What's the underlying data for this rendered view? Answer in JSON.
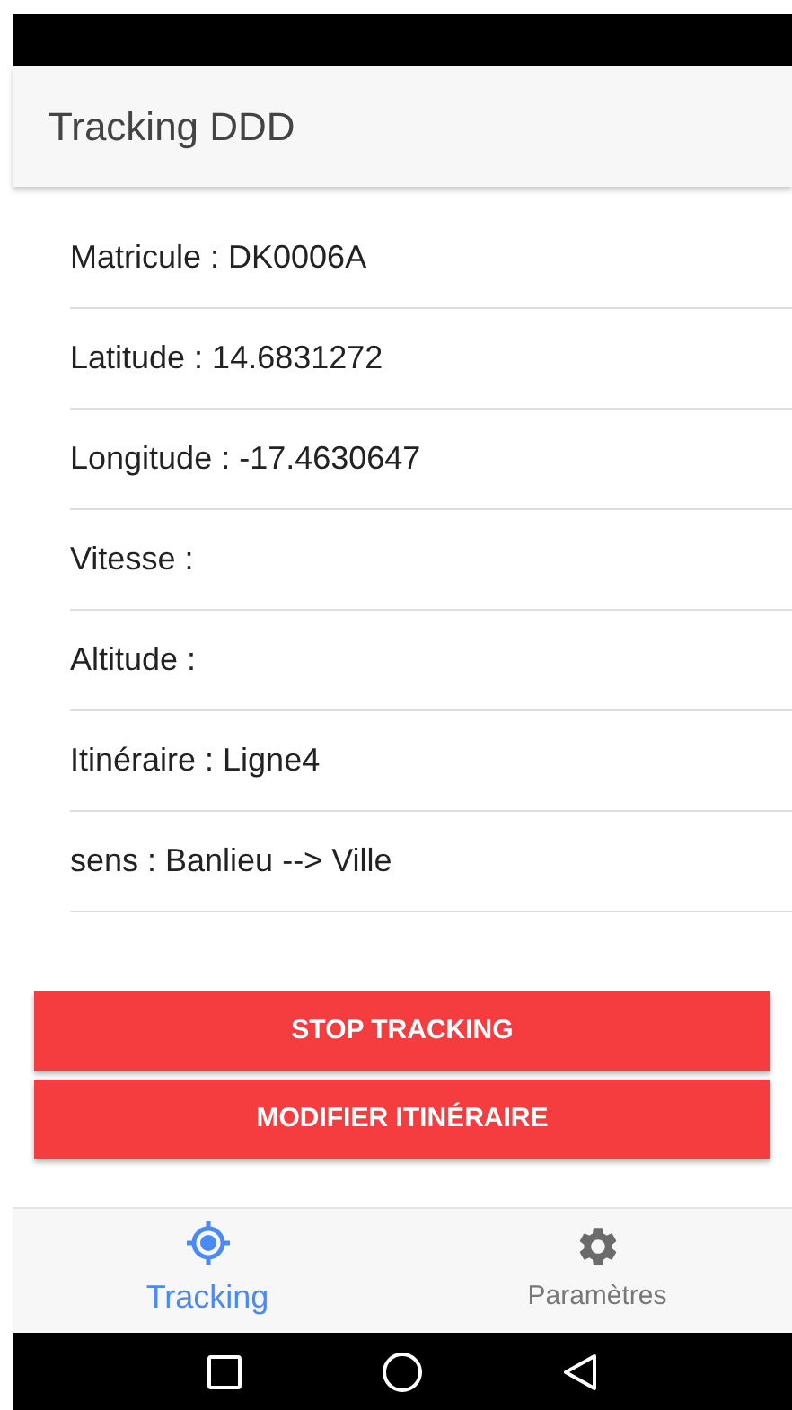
{
  "app_bar": {
    "title": "Tracking DDD"
  },
  "fields": [
    {
      "text": "Matricule : DK0006A"
    },
    {
      "text": "Latitude : 14.6831272"
    },
    {
      "text": "Longitude : -17.4630647"
    },
    {
      "text": "Vitesse :"
    },
    {
      "text": "Altitude :"
    },
    {
      "text": "Itinéraire : Ligne4"
    },
    {
      "text": "sens : Banlieu --> Ville"
    }
  ],
  "buttons": [
    "STOP TRACKING",
    "MODIFIER ITINÉRAIRE"
  ],
  "tabs": [
    {
      "label": "Tracking",
      "kind": "target",
      "selected": true
    },
    {
      "label": "Paramètres",
      "kind": "gear",
      "selected": false
    }
  ]
}
